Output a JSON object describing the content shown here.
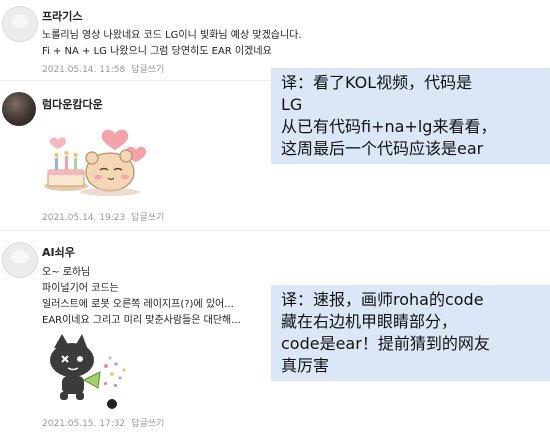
{
  "comments": [
    {
      "author": "프라기스",
      "lines": [
        "노롤리님 영상 나왔네요 코드 LG이니 빛화님 예상 맞겠습니다.",
        "Fi + NA + LG 나왔으니 그럼 당연히도 EAR 이겠네요"
      ],
      "date": "2021.05.14. 11:58",
      "reply": "답글쓰기"
    },
    {
      "author": "럼다운캄다운",
      "lines": [],
      "date": "2021.05.14. 19:23",
      "reply": "답글쓰기"
    },
    {
      "author": "AI쇠우",
      "lines": [
        "오~ 로하님",
        "파이널기어 코드는",
        "일러스트에 로봇 오른쪽 레이지프(?)에 있어...",
        "EAR이네요 그리고 미리 맞춘사람들은 대단해..."
      ],
      "date": "2021.05.15. 17:32",
      "reply": "답글쓰기"
    }
  ],
  "notes": [
    {
      "lines": [
        "译：看了KOL视频，代码是",
        "LG",
        "从已有代码fi+na+lg来看看，",
        "这周最后一个代码应该是ear"
      ]
    },
    {
      "lines": [
        "译：速报，画师roha的code",
        "藏在右边机甲眼睛部分，",
        "code是ear！提前猜到的网友",
        "真厉害"
      ]
    }
  ]
}
